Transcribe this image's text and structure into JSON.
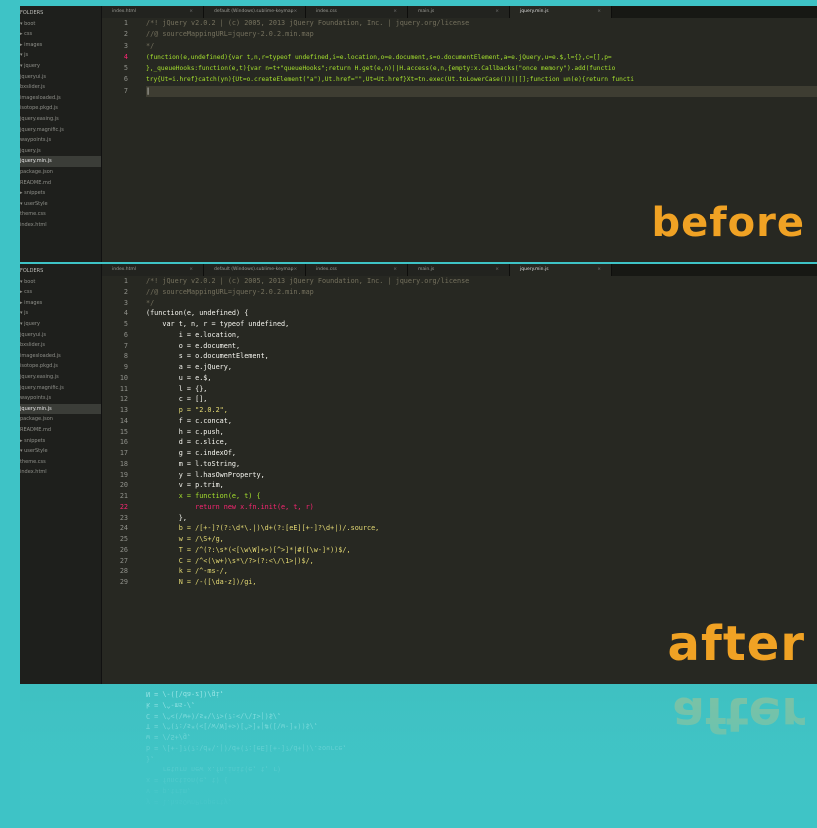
{
  "before": {
    "sidebar": [
      {
        "label": "FOLDERS",
        "type": "head"
      },
      {
        "label": "▾ boot",
        "type": "item"
      },
      {
        "label": "  ▸ css",
        "type": "item"
      },
      {
        "label": "  ▸ images",
        "type": "item"
      },
      {
        "label": "  ▾ js",
        "type": "item"
      },
      {
        "label": "    ▾ jquery",
        "type": "item"
      },
      {
        "label": "       jqueryui.js",
        "type": "item"
      },
      {
        "label": "       bxslider.js",
        "type": "item"
      },
      {
        "label": "       imagesloaded.js",
        "type": "item"
      },
      {
        "label": "       isotope.pkgd.js",
        "type": "item"
      },
      {
        "label": "       jquery.easing.js",
        "type": "item"
      },
      {
        "label": "       jquery.magnific.js",
        "type": "item"
      },
      {
        "label": "       waypoints.js",
        "type": "item"
      },
      {
        "label": "       jquery.js",
        "type": "item"
      },
      {
        "label": "       jquery.min.js",
        "type": "sel"
      },
      {
        "label": "       package.json",
        "type": "item"
      },
      {
        "label": "       README.md",
        "type": "item"
      },
      {
        "label": "  ▸ snippets",
        "type": "item"
      },
      {
        "label": "▾ userStyle",
        "type": "item"
      },
      {
        "label": "     theme.css",
        "type": "item"
      },
      {
        "label": "     index.html",
        "type": "item"
      }
    ],
    "tabs": [
      {
        "label": "index.html",
        "active": false
      },
      {
        "label": "default (Windows).sublime-keymap",
        "active": false
      },
      {
        "label": "index.css",
        "active": false
      },
      {
        "label": "main.js",
        "active": false
      },
      {
        "label": "jquery.min.js",
        "active": true
      }
    ],
    "lines": [
      {
        "n": "1",
        "t": "/*! jQuery v2.0.2 | (c) 2005, 2013 jQuery Foundation, Inc. | jquery.org/license",
        "c": "cmt"
      },
      {
        "n": "2",
        "t": "//@ sourceMappingURL=jquery-2.0.2.min.map",
        "c": "cmt"
      },
      {
        "n": "3",
        "t": "*/",
        "c": "cmt"
      },
      {
        "n": "4",
        "t": "(function(e,undefined){var t,n,r=typeof undefined,i=e.location,o=e.document,s=o.documentElement,a=e.jQuery,u=e.$,l={},c=[],p=",
        "c": "dense"
      },
      {
        "n": "5",
        "t": "},_queueHooks:function(e,t){var n=t+\"queueHooks\";return H.get(e,n)||H.access(e,n,{empty:x.Callbacks(\"once memory\").add(functio",
        "c": "dense"
      },
      {
        "n": "6",
        "t": "try{Ut=i.href}catch(yn){Ut=o.createElement(\"a\"),Ut.href=\"\",Ut=Ut.href}Xt=tn.exec(Ut.toLowerCase())||[];function un(e){return functi",
        "c": "dense"
      },
      {
        "n": "7",
        "t": "|",
        "c": "plain"
      }
    ],
    "stamp": "before"
  },
  "after": {
    "sidebar": [
      {
        "label": "FOLDERS",
        "type": "head"
      },
      {
        "label": "▾ boot",
        "type": "item"
      },
      {
        "label": "  ▸ css",
        "type": "item"
      },
      {
        "label": "  ▸ images",
        "type": "item"
      },
      {
        "label": "  ▾ js",
        "type": "item"
      },
      {
        "label": "    ▾ jquery",
        "type": "item"
      },
      {
        "label": "       jqueryui.js",
        "type": "item"
      },
      {
        "label": "       bxslider.js",
        "type": "item"
      },
      {
        "label": "       imagesloaded.js",
        "type": "item"
      },
      {
        "label": "       isotope.pkgd.js",
        "type": "item"
      },
      {
        "label": "       jquery.easing.js",
        "type": "item"
      },
      {
        "label": "       jquery.magnific.js",
        "type": "item"
      },
      {
        "label": "       waypoints.js",
        "type": "item"
      },
      {
        "label": "       jquery.min.js",
        "type": "sel"
      },
      {
        "label": "       package.json",
        "type": "item"
      },
      {
        "label": "       README.md",
        "type": "item"
      },
      {
        "label": "  ▸ snippets",
        "type": "item"
      },
      {
        "label": "▾ userStyle",
        "type": "item"
      },
      {
        "label": "     theme.css",
        "type": "item"
      },
      {
        "label": "     index.html",
        "type": "item"
      }
    ],
    "tabs": [
      {
        "label": "index.html",
        "active": false
      },
      {
        "label": "default (Windows).sublime-keymap",
        "active": false
      },
      {
        "label": "index.css",
        "active": false
      },
      {
        "label": "main.js",
        "active": false
      },
      {
        "label": "jquery.min.js",
        "active": true
      }
    ],
    "lines": [
      {
        "n": "1",
        "t": "/*! jQuery v2.0.2 | (c) 2005, 2013 jQuery Foundation, Inc. | jquery.org/license",
        "c": "cmt"
      },
      {
        "n": "2",
        "t": "//@ sourceMappingURL=jquery-2.0.2.min.map",
        "c": "cmt"
      },
      {
        "n": "3",
        "t": "*/",
        "c": "cmt"
      },
      {
        "n": "4",
        "t": "(function(e, undefined) {",
        "c": "plain"
      },
      {
        "n": "5",
        "t": "    var t, n, r = typeof undefined,",
        "c": "plain"
      },
      {
        "n": "6",
        "t": "        i = e.location,",
        "c": "plain"
      },
      {
        "n": "7",
        "t": "        o = e.document,",
        "c": "plain"
      },
      {
        "n": "8",
        "t": "        s = o.documentElement,",
        "c": "plain"
      },
      {
        "n": "9",
        "t": "        a = e.jQuery,",
        "c": "plain"
      },
      {
        "n": "10",
        "t": "        u = e.$,",
        "c": "plain"
      },
      {
        "n": "11",
        "t": "        l = {},",
        "c": "plain"
      },
      {
        "n": "12",
        "t": "        c = [],",
        "c": "plain"
      },
      {
        "n": "13",
        "t": "        p = \"2.0.2\",",
        "c": "s"
      },
      {
        "n": "14",
        "t": "        f = c.concat,",
        "c": "plain"
      },
      {
        "n": "15",
        "t": "        h = c.push,",
        "c": "plain"
      },
      {
        "n": "16",
        "t": "        d = c.slice,",
        "c": "plain"
      },
      {
        "n": "17",
        "t": "        g = c.indexOf,",
        "c": "plain"
      },
      {
        "n": "18",
        "t": "        m = l.toString,",
        "c": "plain"
      },
      {
        "n": "19",
        "t": "        y = l.hasOwnProperty,",
        "c": "plain"
      },
      {
        "n": "20",
        "t": "        v = p.trim,",
        "c": "plain"
      },
      {
        "n": "21",
        "t": "        x = function(e, t) {",
        "c": "f"
      },
      {
        "n": "22",
        "t": "            return new x.fn.init(e, t, r)",
        "c": "k"
      },
      {
        "n": "23",
        "t": "        },",
        "c": "plain"
      },
      {
        "n": "24",
        "t": "        b = /[+-]?(?:\\d*\\.|)\\d+(?:[eE][+-]?\\d+|)/.source,",
        "c": "s"
      },
      {
        "n": "25",
        "t": "        w = /\\S+/g,",
        "c": "s"
      },
      {
        "n": "26",
        "t": "        T = /^(?:\\s*(<[\\w\\W]+>)[^>]*|#([\\w-]*))$/,",
        "c": "s"
      },
      {
        "n": "27",
        "t": "        C = /^<(\\w+)\\s*\\/?>(?:<\\/\\1>|)$/,",
        "c": "s"
      },
      {
        "n": "28",
        "t": "        k = /^-ms-/,",
        "c": "s"
      },
      {
        "n": "29",
        "t": "        N = /-([\\da-z])/gi,",
        "c": "s"
      }
    ],
    "stamp": "after"
  },
  "reflection": {
    "lines": [
      "N = /-([\\da-z])/gi,",
      "k = /^-ms-/,",
      "C = /^<(\\w+)\\s*\\/?>(?:<\\/\\1>|)$/,",
      "T = /^(?:\\s*(<[\\w\\W]+>)[^>]*|#([\\w-]*))$/,",
      "w = /\\S+/g,",
      "b = /[+-]?(?:\\d*\\.|)\\d+(?:[eE][+-]?\\d+|)/.source,",
      "},",
      "    return new x.fn.init(e, t, r)",
      "x = function(e, t) {",
      "v = p.trim,",
      "y = l.hasOwnProperty,"
    ],
    "stamp": "after"
  }
}
